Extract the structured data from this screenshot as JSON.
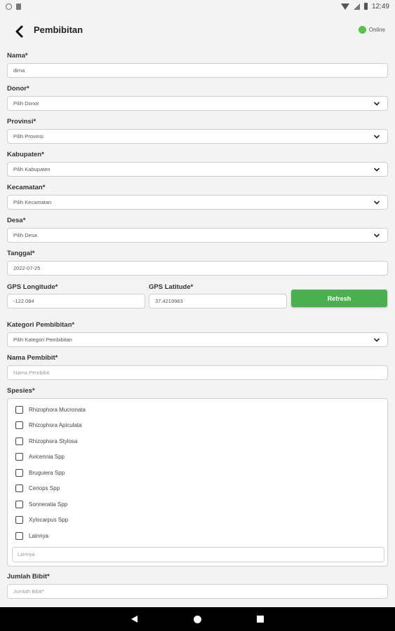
{
  "status_bar": {
    "time": "12:49"
  },
  "header": {
    "title": "Pembibitan",
    "connection_status": "Online",
    "status_color": "#5cbf4a"
  },
  "form": {
    "nama": {
      "label": "Nama*",
      "value": "dima"
    },
    "donor": {
      "label": "Donor*",
      "selected": "Pilih Donor"
    },
    "provinsi": {
      "label": "Provinsi*",
      "selected": "Pilih Provinsi"
    },
    "kabupaten": {
      "label": "Kabupaten*",
      "selected": "Pilih Kabupaten"
    },
    "kecamatan": {
      "label": "Kecamatan*",
      "selected": "Pilih Kecamatan"
    },
    "desa": {
      "label": "Desa*",
      "selected": "Pilih Desa"
    },
    "tanggal": {
      "label": "Tanggal*",
      "value": "2022-07-25"
    },
    "gps_longitude": {
      "label": "GPS Longitude*",
      "value": "-122.084"
    },
    "gps_latitude": {
      "label": "GPS Latitude*",
      "value": "37.4219983"
    },
    "refresh_label": "Refresh",
    "kategori": {
      "label": "Kategori Pembibitan*",
      "selected": "Pilih Kategori Pembibitan"
    },
    "nama_pembibit": {
      "label": "Nama Pembibit*",
      "placeholder": "Nama Pembibit"
    },
    "spesies": {
      "label": "Spesies*",
      "options": [
        "Rhizophora Mucronata",
        "Rhizophora Apiculata",
        "Rhizophora Stylosa",
        "Avicennia Spp",
        "Bruguiera Spp",
        "Ceriops Spp",
        "Sonneratia Spp",
        "Xylocarpus Spp",
        "Lainnya"
      ],
      "lainnya_placeholder": "Lainnya"
    },
    "jumlah_bibit": {
      "label": "Jumlah Bibit*",
      "placeholder": "Jumlah Bibit*"
    }
  },
  "colors": {
    "accent": "#4caf50",
    "background": "#f3f3f3"
  }
}
